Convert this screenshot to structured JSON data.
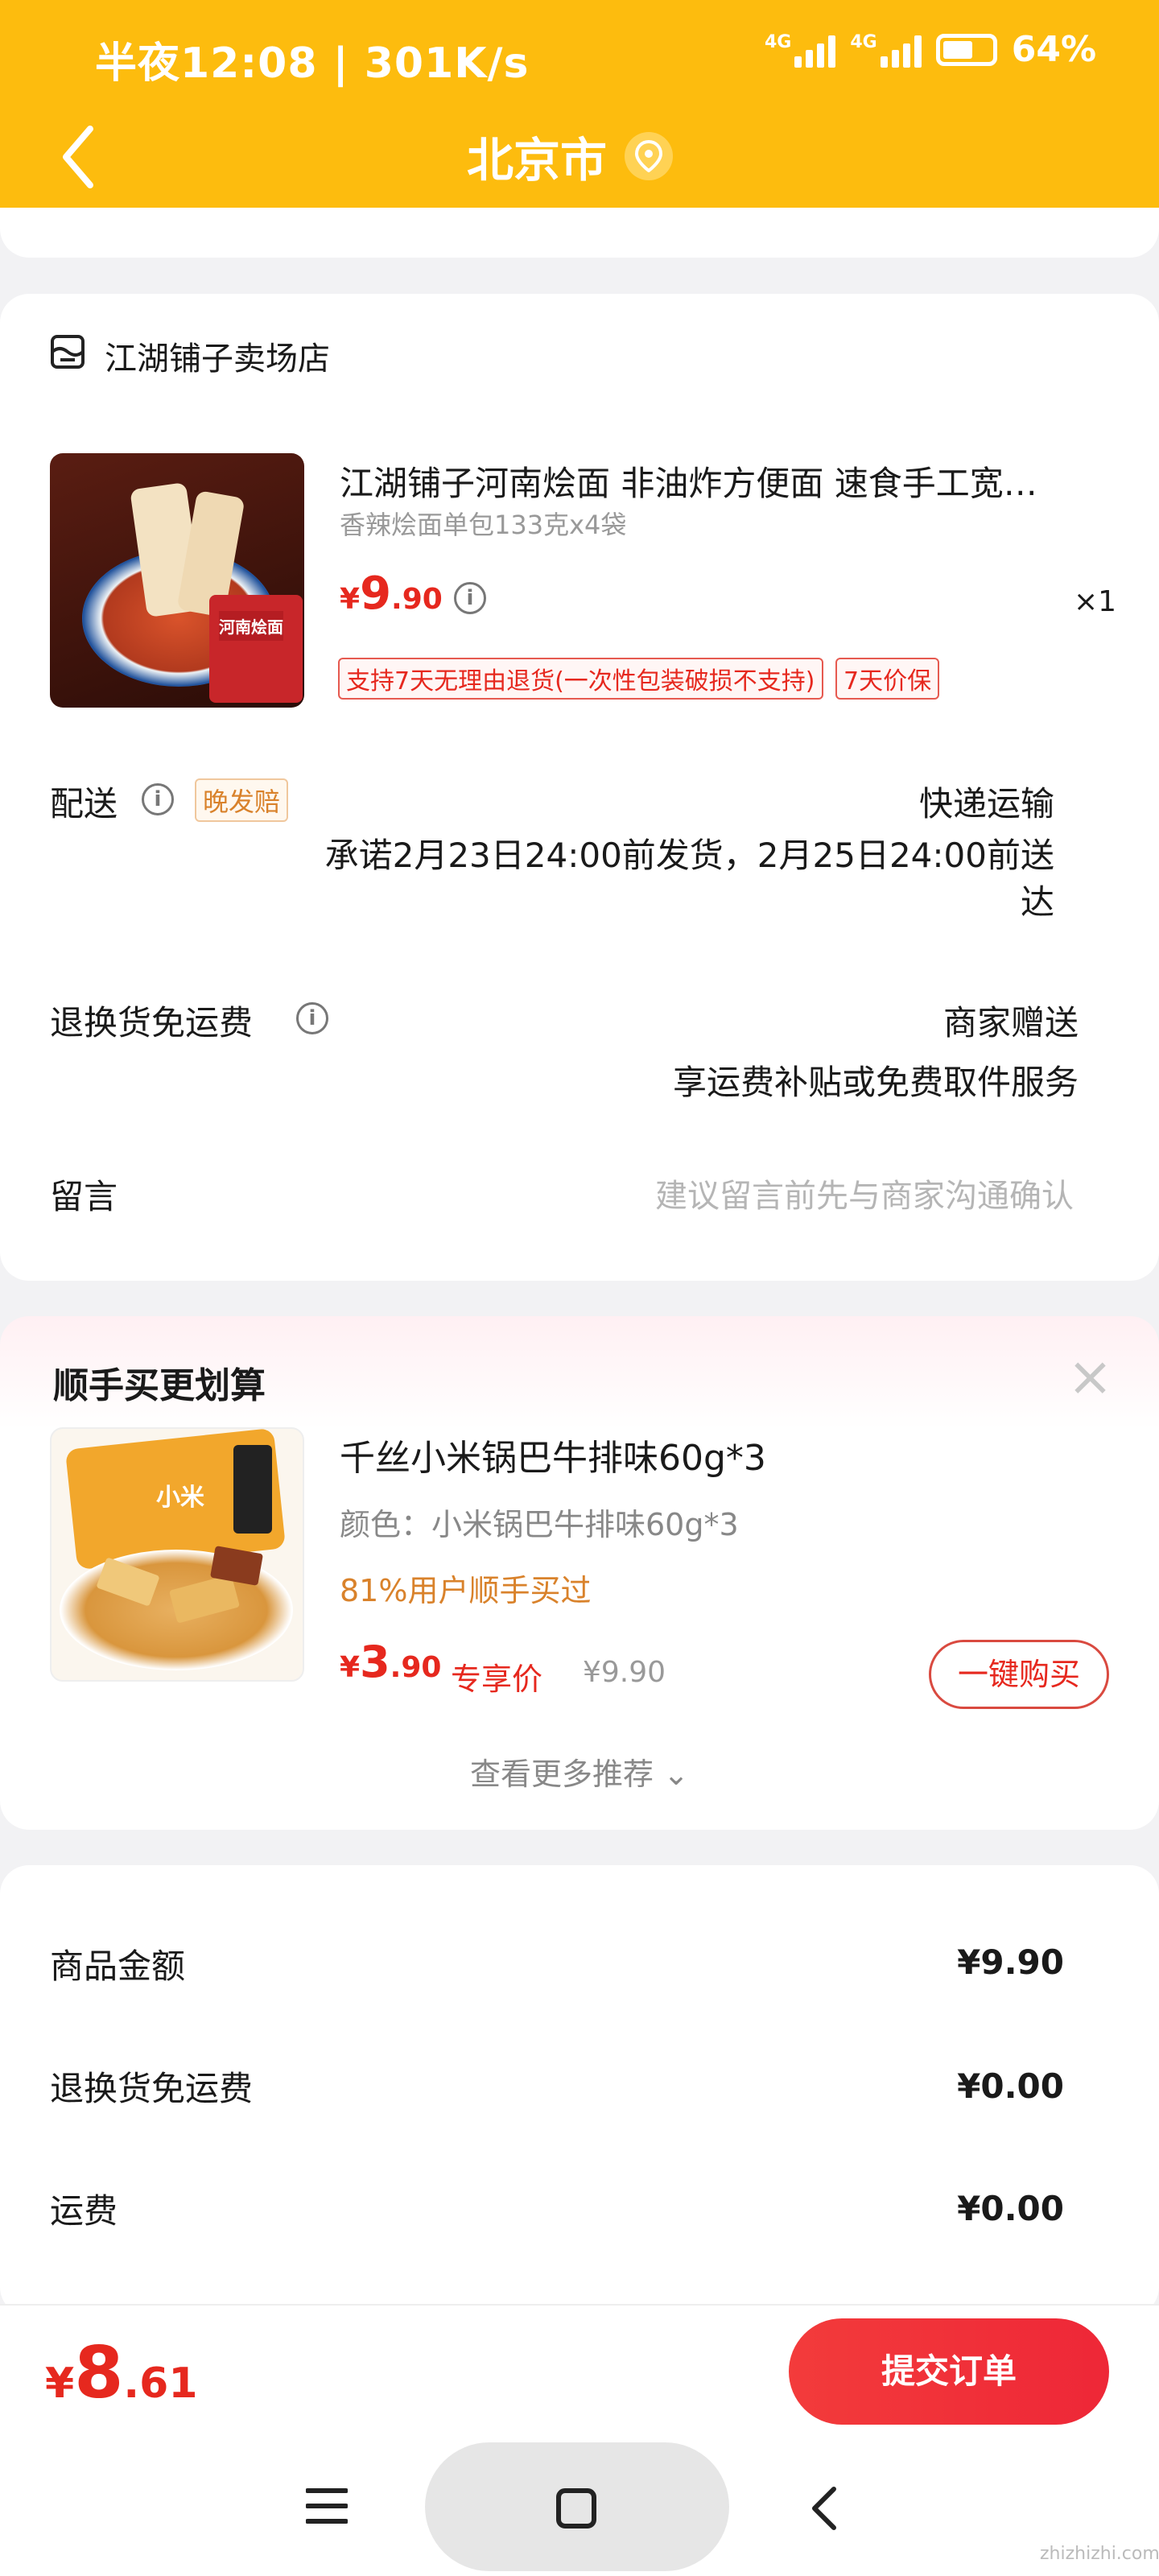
{
  "status": {
    "time": "半夜12:08 | 301K/s",
    "net1": "4G",
    "net2": "4G",
    "battery": "64%"
  },
  "header": {
    "title": "北京市"
  },
  "store": {
    "name": "江湖铺子卖场店"
  },
  "product": {
    "title": "江湖铺子河南烩面 非油炸方便面 速食手工宽…",
    "spec": "香辣烩面单包133克x4袋",
    "price_symbol": "¥",
    "price_int": "9",
    "price_dec": ".90",
    "qty": "×1",
    "tag1": "支持7天无理由退货(一次性包装破损不支持)",
    "tag2": "7天价保",
    "image_caption": "河南烩面"
  },
  "delivery": {
    "label": "配送",
    "badge": "晚发赔",
    "method": "快递运输",
    "promise_line1": "承诺2月23日24:00前发货，2月25日24:00前送",
    "promise_line2": "达"
  },
  "return_shipping": {
    "label": "退换货免运费",
    "value": "商家赠送",
    "desc": "享运费补贴或免费取件服务"
  },
  "message": {
    "label": "留言",
    "placeholder": "建议留言前先与商家沟通确认"
  },
  "recommend": {
    "title": "顺手买更划算",
    "close": "×",
    "item_name": "千丝小米锅巴牛排味60g*3",
    "item_color": "颜色：小米锅巴牛排味60g*3",
    "buy_rate": "81%用户顺手买过",
    "price_symbol": "¥",
    "price_int": "3",
    "price_dec": ".90",
    "price_tag": "专享价",
    "orig_price": "¥9.90",
    "buy_button": "一键购买",
    "more": "查看更多推荐 ⌄",
    "image_caption": "小米"
  },
  "summary": {
    "rows": [
      {
        "label": "商品金额",
        "value": "¥9.90"
      },
      {
        "label": "退换货免运费",
        "value": "¥0.00"
      },
      {
        "label": "运费",
        "value": "¥0.00"
      }
    ]
  },
  "bottom": {
    "total_symbol": "¥",
    "total_int": "8",
    "total_dec": ".61",
    "submit": "提交订单"
  },
  "watermark": "zhizhizhi.com",
  "colors": {
    "header_bg": "#fdbc0e",
    "price_red": "#e6281e",
    "orange_text": "#d9822b"
  }
}
